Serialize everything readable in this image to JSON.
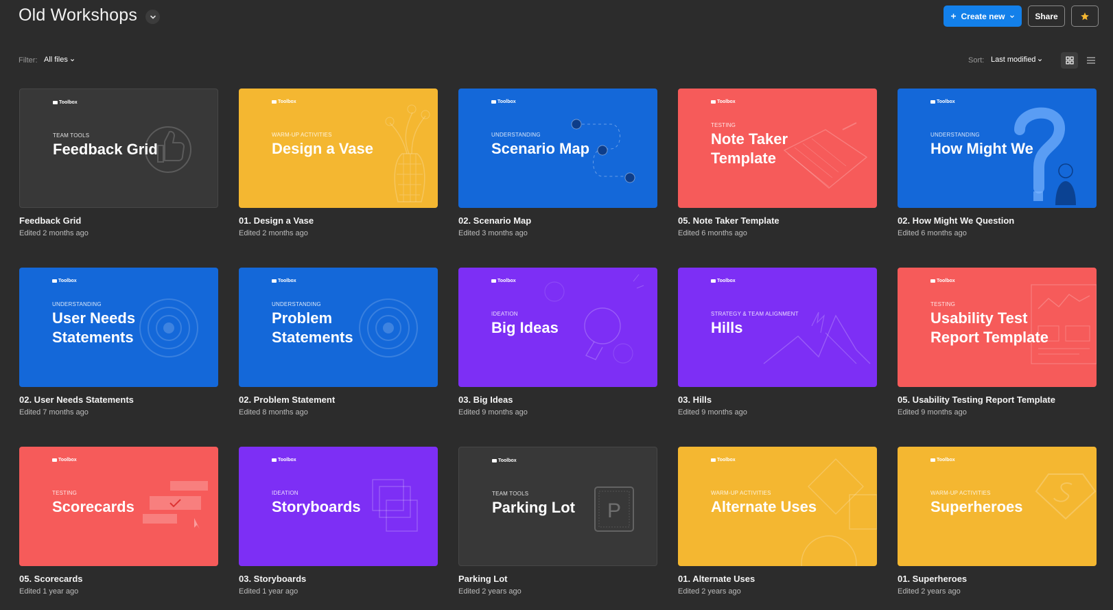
{
  "header": {
    "title": "Old Workshops",
    "create_label": "Create new",
    "share_label": "Share"
  },
  "filter": {
    "label": "Filter:",
    "value": "All files"
  },
  "sort": {
    "label": "Sort:",
    "value": "Last modified"
  },
  "colors": {
    "background": "#2c2c2c",
    "accent": "#1380ea",
    "dark_card": "#383838",
    "yellow_card": "#f4b731",
    "blue_card": "#1468d9",
    "red_card": "#f65b5a",
    "purple_card": "#7d2ff5"
  },
  "cards": [
    {
      "brand": "Toolbox",
      "category": "TEAM TOOLS",
      "heading": "Feedback Grid",
      "name": "Feedback Grid",
      "edited": "Edited 2 months ago",
      "color": "#383838",
      "icon": "thumbs-up-icon"
    },
    {
      "brand": "Toolbox",
      "category": "WARM-UP ACTIVITIES",
      "heading": "Design a Vase",
      "name": "01. Design a Vase",
      "edited": "Edited 2 months ago",
      "color": "#f4b731",
      "icon": "vase-icon"
    },
    {
      "brand": "Toolbox",
      "category": "UNDERSTANDING",
      "heading": "Scenario Map",
      "name": "02. Scenario Map",
      "edited": "Edited 3 months ago",
      "color": "#1468d9",
      "icon": "path-icon"
    },
    {
      "brand": "Toolbox",
      "category": "TESTING",
      "heading": "Note Taker Template",
      "name": "05. Note Taker Template",
      "edited": "Edited 6 months ago",
      "color": "#f65b5a",
      "icon": "notebook-icon"
    },
    {
      "brand": "Toolbox",
      "category": "UNDERSTANDING",
      "heading": "How Might We",
      "name": "02. How Might We Question",
      "edited": "Edited 6 months ago",
      "color": "#1468d9",
      "icon": "question-mark-icon"
    },
    {
      "brand": "Toolbox",
      "category": "UNDERSTANDING",
      "heading": "User Needs Statements",
      "name": "02. User Needs Statements",
      "edited": "Edited 7 months ago",
      "color": "#1468d9",
      "icon": "target-icon"
    },
    {
      "brand": "Toolbox",
      "category": "UNDERSTANDING",
      "heading": "Problem Statements",
      "name": "02. Problem Statement",
      "edited": "Edited 8 months ago",
      "color": "#1468d9",
      "icon": "target-icon"
    },
    {
      "brand": "Toolbox",
      "category": "IDEATION",
      "heading": "Big Ideas",
      "name": "03. Big Ideas",
      "edited": "Edited 9 months ago",
      "color": "#7d2ff5",
      "icon": "lightbulb-icon"
    },
    {
      "brand": "Toolbox",
      "category": "STRATEGY & TEAM ALIGNMENT",
      "heading": "Hills",
      "name": "03. Hills",
      "edited": "Edited 9 months ago",
      "color": "#7d2ff5",
      "icon": "mountain-icon"
    },
    {
      "brand": "Toolbox",
      "category": "TESTING",
      "heading": "Usability Test Report Template",
      "name": "05. Usability Testing Report Template",
      "edited": "Edited 9 months ago",
      "color": "#f65b5a",
      "icon": "report-icon"
    },
    {
      "brand": "Toolbox",
      "category": "TESTING",
      "heading": "Scorecards",
      "name": "05. Scorecards",
      "edited": "Edited 1 year ago",
      "color": "#f65b5a",
      "icon": "scorecard-icon"
    },
    {
      "brand": "Toolbox",
      "category": "IDEATION",
      "heading": "Storyboards",
      "name": "03. Storyboards",
      "edited": "Edited 1 year ago",
      "color": "#7d2ff5",
      "icon": "stacked-frames-icon"
    },
    {
      "brand": "Toolbox",
      "category": "TEAM TOOLS",
      "heading": "Parking Lot",
      "name": "Parking Lot",
      "edited": "Edited 2 years ago",
      "color": "#383838",
      "icon": "parking-icon"
    },
    {
      "brand": "Toolbox",
      "category": "WARM-UP ACTIVITIES",
      "heading": "Alternate Uses",
      "name": "01. Alternate Uses",
      "edited": "Edited 2 years ago",
      "color": "#f4b731",
      "icon": "shapes-icon"
    },
    {
      "brand": "Toolbox",
      "category": "WARM-UP ACTIVITIES",
      "heading": "Superheroes",
      "name": "01. Superheroes",
      "edited": "Edited 2 years ago",
      "color": "#f4b731",
      "icon": "superhero-icon"
    }
  ]
}
